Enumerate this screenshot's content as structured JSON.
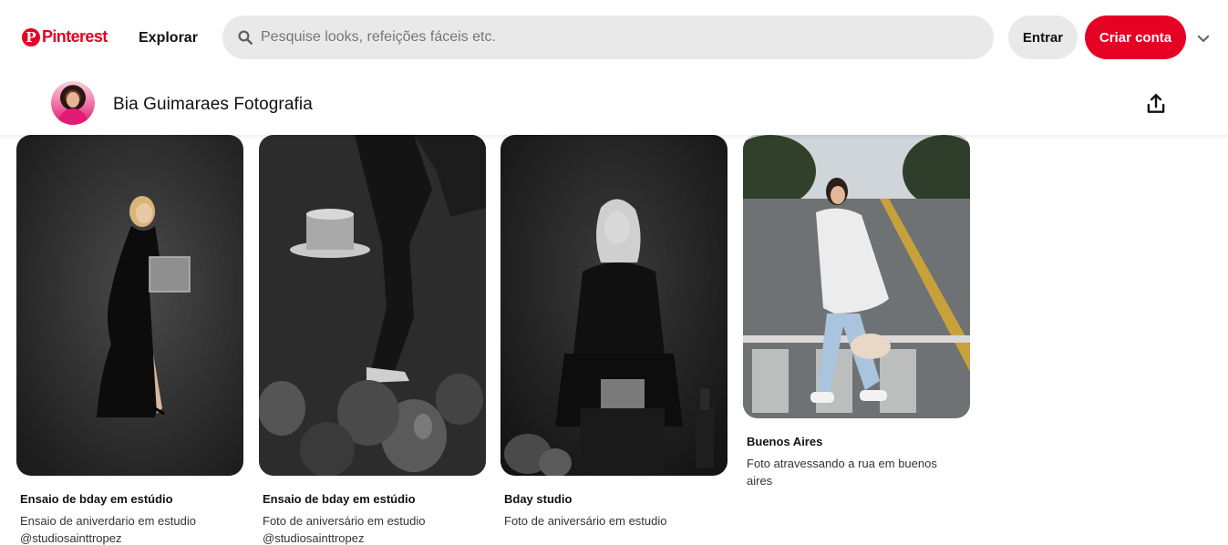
{
  "header": {
    "logo_text": "Pinterest",
    "logo_mark": "P",
    "explore_label": "Explorar",
    "search_placeholder": "Pesquise looks, refeições fáceis etc.",
    "login_label": "Entrar",
    "signup_label": "Criar conta",
    "accent_color": "#e60023"
  },
  "profile": {
    "name": "Bia Guimaraes Fotografia",
    "share_icon": "share-icon"
  },
  "pins": [
    {
      "title": "Ensaio de bday em estúdio",
      "description": "Ensaio de aniverdario em estudio @studiosainttropez"
    },
    {
      "title": "Ensaio de bday em estúdio",
      "description": "Foto de aniversário em estudio @studiosainttropez"
    },
    {
      "title": "Bday studio",
      "description": "Foto de aniversário em estudio"
    },
    {
      "title": "Buenos Aires",
      "description": "Foto atravessando a rua em buenos aires"
    }
  ]
}
